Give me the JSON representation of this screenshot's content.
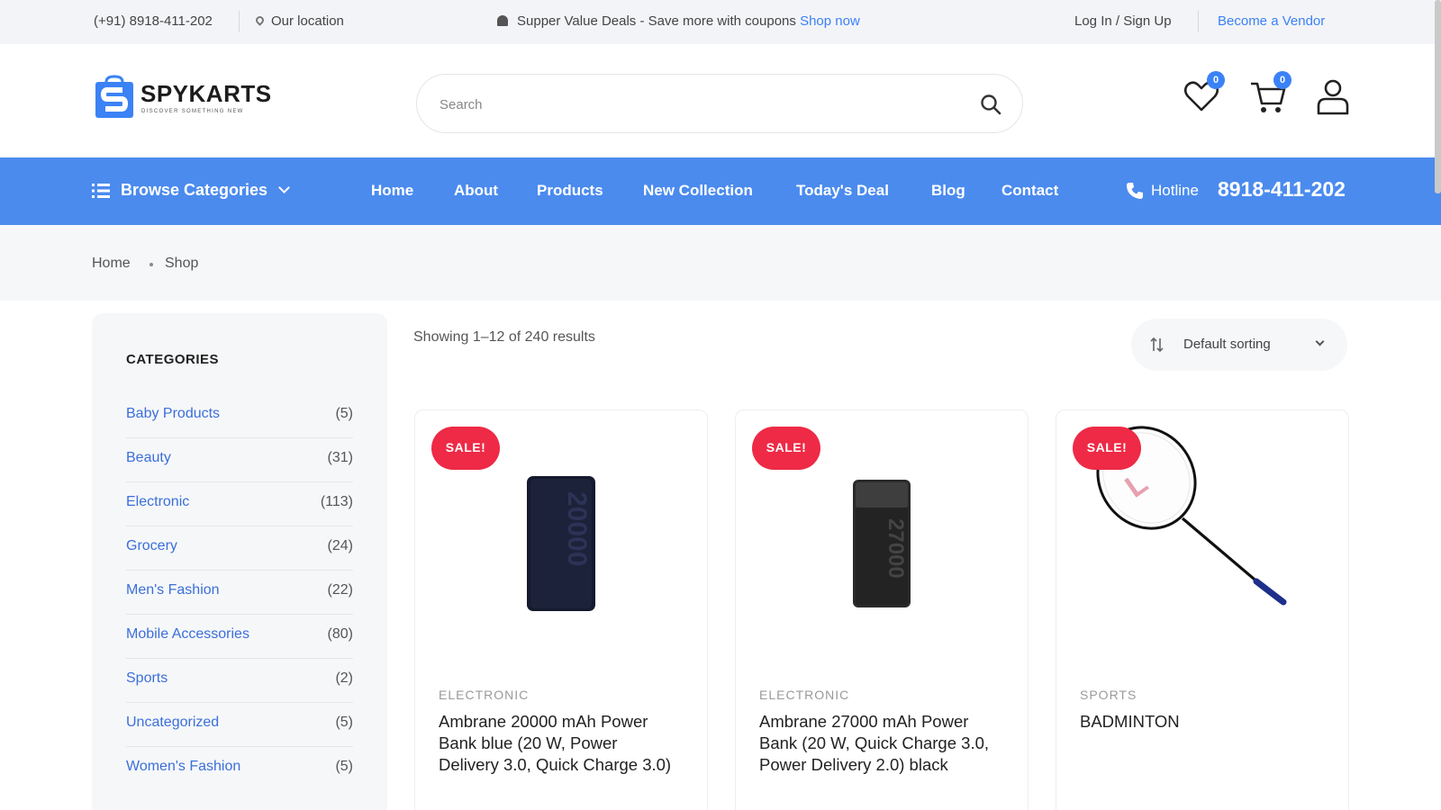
{
  "topbar": {
    "phone": "(+91) 8918-411-202",
    "location": "Our location",
    "promo_text": "Supper Value Deals - Save more with coupons",
    "promo_link": "Shop now",
    "login": "Log In / Sign Up",
    "vendor": "Become a Vendor"
  },
  "header": {
    "logo_name": "SPYKARTS",
    "logo_tagline": "DISCOVER SOMETHING NEW",
    "search_placeholder": "Search",
    "wishlist_count": "0",
    "cart_count": "0"
  },
  "nav": {
    "browse": "Browse Categories",
    "links": [
      "Home",
      "About",
      "Products",
      "New Collection",
      "Today's Deal",
      "Blog",
      "Contact"
    ],
    "hotline_label": "Hotline",
    "hotline_number": "8918-411-202"
  },
  "breadcrumb": [
    "Home",
    "Shop"
  ],
  "sidebar": {
    "title": "CATEGORIES",
    "categories": [
      {
        "name": "Baby Products",
        "count": "(5)"
      },
      {
        "name": "Beauty",
        "count": "(31)"
      },
      {
        "name": "Electronic",
        "count": "(113)"
      },
      {
        "name": "Grocery",
        "count": "(24)"
      },
      {
        "name": "Men's Fashion",
        "count": "(22)"
      },
      {
        "name": "Mobile Accessories",
        "count": "(80)"
      },
      {
        "name": "Sports",
        "count": "(2)"
      },
      {
        "name": "Uncategorized",
        "count": "(5)"
      },
      {
        "name": "Women's Fashion",
        "count": "(5)"
      }
    ]
  },
  "results": {
    "showing": "Showing 1–12 of 240 results",
    "sort": "Default sorting"
  },
  "products": [
    {
      "badge": "SALE!",
      "category": "ELECTRONIC",
      "name": "Ambrane 20000 mAh Power Bank blue (20 W, Power Delivery 3.0, Quick Charge 3.0)",
      "image": "power-bank-20000"
    },
    {
      "badge": "SALE!",
      "category": "ELECTRONIC",
      "name": "Ambrane 27000 mAh Power Bank (20 W, Quick Charge 3.0, Power Delivery 2.0) black",
      "image": "power-bank-27000"
    },
    {
      "badge": "SALE!",
      "category": "SPORTS",
      "name": "BADMINTON",
      "image": "badminton-racket"
    }
  ],
  "colors": {
    "accent": "#3b82f6",
    "nav_bg": "#4b8bee",
    "sale_badge": "#ee2a46"
  }
}
